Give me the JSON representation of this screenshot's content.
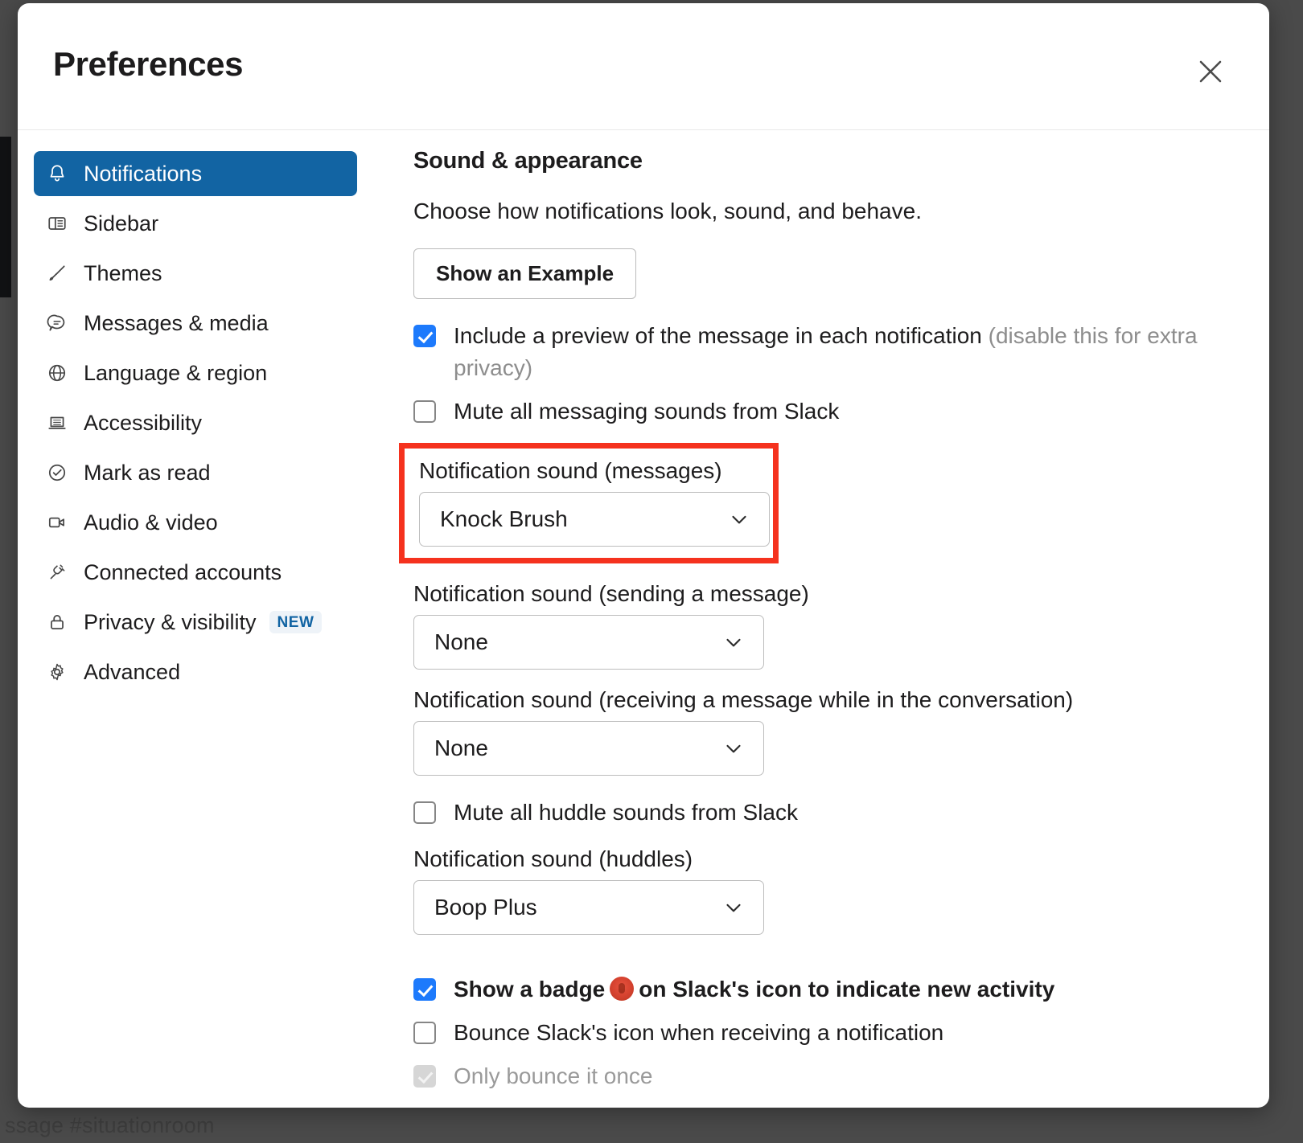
{
  "background": {
    "peek_text": "ssage  #situationroom"
  },
  "dialog": {
    "title": "Preferences",
    "close_icon": "close-icon"
  },
  "sidebar": {
    "items": [
      {
        "label": "Notifications",
        "icon": "bell-icon",
        "active": true
      },
      {
        "label": "Sidebar",
        "icon": "sidebar-layout-icon",
        "active": false
      },
      {
        "label": "Themes",
        "icon": "paintbrush-icon",
        "active": false
      },
      {
        "label": "Messages & media",
        "icon": "chat-bubble-icon",
        "active": false
      },
      {
        "label": "Language & region",
        "icon": "globe-icon",
        "active": false
      },
      {
        "label": "Accessibility",
        "icon": "laptop-icon",
        "active": false
      },
      {
        "label": "Mark as read",
        "icon": "check-circle-icon",
        "active": false
      },
      {
        "label": "Audio & video",
        "icon": "video-camera-icon",
        "active": false
      },
      {
        "label": "Connected accounts",
        "icon": "plug-icon",
        "active": false
      },
      {
        "label": "Privacy & visibility",
        "icon": "lock-icon",
        "active": false,
        "badge": "NEW"
      },
      {
        "label": "Advanced",
        "icon": "gear-icon",
        "active": false
      }
    ]
  },
  "main": {
    "section_title": "Sound & appearance",
    "section_description": "Choose how notifications look, sound, and behave.",
    "example_button": "Show an Example",
    "preview": {
      "label_main": "Include a preview of the message in each notification",
      "label_muted": " (disable this for extra privacy)",
      "checked": true
    },
    "mute_messaging": {
      "label": "Mute all messaging sounds from Slack",
      "checked": false
    },
    "sound_messages": {
      "label": "Notification sound (messages)",
      "value": "Knock Brush",
      "highlighted": true
    },
    "sound_sending": {
      "label": "Notification sound (sending a message)",
      "value": "None"
    },
    "sound_receiving": {
      "label": "Notification sound (receiving a message while in the conversation)",
      "value": "None"
    },
    "mute_huddle": {
      "label": "Mute all huddle sounds from Slack",
      "checked": false
    },
    "sound_huddles": {
      "label": "Notification sound (huddles)",
      "value": "Boop Plus"
    },
    "show_badge": {
      "label_before": "Show a badge",
      "label_after": "on Slack's icon to indicate new activity",
      "badge_icon": "red-badge-icon",
      "checked": true
    },
    "bounce_icon": {
      "label": "Bounce Slack's icon when receiving a notification",
      "checked": false
    },
    "bounce_once": {
      "label": "Only bounce it once",
      "checked": true,
      "disabled": true
    }
  },
  "colors": {
    "accent": "#1264a3",
    "checkbox_checked": "#1d7afc",
    "highlight": "#f5321e",
    "badge_red": "#d5422f"
  }
}
